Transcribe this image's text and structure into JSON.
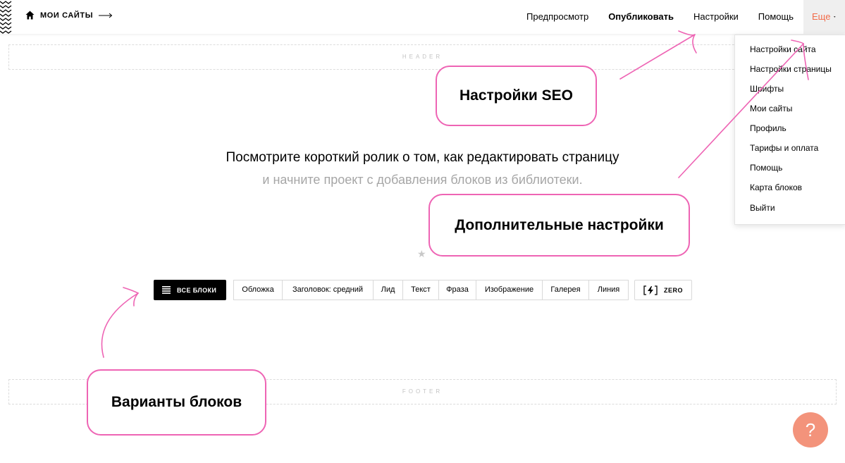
{
  "header_bar": {
    "home_label": "МОИ САЙТЫ",
    "nav": [
      {
        "label": "Предпросмотр"
      },
      {
        "label": "Опубликовать"
      },
      {
        "label": "Настройки"
      },
      {
        "label": "Помощь"
      }
    ],
    "more_label": "Еще"
  },
  "more_menu": {
    "items": [
      "Настройки сайта",
      "Настройки страницы",
      "Шрифты",
      "Мои сайты",
      "Профиль",
      "Тарифы и оплата",
      "Помощь",
      "Карта блоков",
      "Выйти"
    ]
  },
  "page": {
    "header_placeholder": "HEADER",
    "footer_placeholder": "FOOTER",
    "title": "Посмотрите короткий ролик о том, как редактировать страницу",
    "subtitle": "и начните проект с добавления блоков из библиотеки."
  },
  "blocks_bar": {
    "all_label": "ВСЕ БЛОКИ",
    "categories": [
      "Обложка",
      "Заголовок: средний",
      "Лид",
      "Текст",
      "Фраза",
      "Изображение",
      "Галерея",
      "Линия"
    ],
    "zero_label": "ZERO"
  },
  "callouts": {
    "seo": "Настройки SEO",
    "extra": "Дополнительные настройки",
    "variants": "Варианты блоков"
  },
  "help_button": {
    "label": "?"
  },
  "colors": {
    "accent": "#f26b49",
    "annotation": "#ee64b4",
    "help_button": "#f3937b"
  },
  "icons": {
    "home": "home-icon",
    "arrow": "long-arrow-right-icon",
    "caret": "caret-down-icon",
    "list": "list-icon",
    "zero": "zero-block-icon",
    "star": "star-icon"
  }
}
